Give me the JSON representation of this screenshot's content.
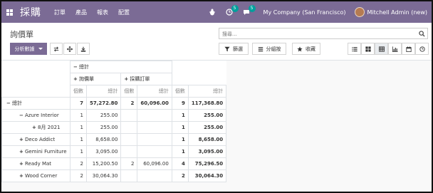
{
  "navbar": {
    "app_title": "採購",
    "menu": [
      "訂單",
      "產品",
      "報表",
      "配置"
    ],
    "chat_badge": "5",
    "activity_badge": "5",
    "company": "My Company (San Francisco)",
    "user": "Mitchell Admin (new)",
    "bg_color": "#7b6b95"
  },
  "control_panel": {
    "breadcrumb": "詢價單",
    "search_placeholder": "搜尋...",
    "measures_label": "分析數據",
    "filter_label": "篩選",
    "groupby_label": "分組按",
    "favorites_label": "收藏"
  },
  "pivot": {
    "col_total": "總計",
    "col_groups": [
      "詢價單",
      "採購訂單"
    ],
    "measures": [
      "個數",
      "總計"
    ],
    "total_row": {
      "label": "總計",
      "c1": "7",
      "v1": "57,272.80",
      "c2": "2",
      "v2": "60,096.00",
      "c3": "9",
      "v3": "117,368.80"
    },
    "rows": [
      {
        "label": "Azure Interior",
        "toggle": "−",
        "c1": "1",
        "v1": "255.00",
        "c2": "",
        "v2": "",
        "c3": "1",
        "v3": "255.00"
      },
      {
        "label": "8月 2021",
        "toggle": "+",
        "c1": "1",
        "v1": "255.00",
        "c2": "",
        "v2": "",
        "c3": "1",
        "v3": "255.00"
      },
      {
        "label": "Deco Addict",
        "toggle": "+",
        "c1": "1",
        "v1": "8,658.00",
        "c2": "",
        "v2": "",
        "c3": "1",
        "v3": "8,658.00"
      },
      {
        "label": "Gemini Furniture",
        "toggle": "+",
        "c1": "1",
        "v1": "3,095.00",
        "c2": "",
        "v2": "",
        "c3": "1",
        "v3": "3,095.00"
      },
      {
        "label": "Ready Mat",
        "toggle": "+",
        "c1": "2",
        "v1": "15,200.50",
        "c2": "2",
        "v2": "60,096.00",
        "c3": "4",
        "v3": "75,296.50"
      },
      {
        "label": "Wood Corner",
        "toggle": "+",
        "c1": "2",
        "v1": "30,064.30",
        "c2": "",
        "v2": "",
        "c3": "2",
        "v3": "30,064.30"
      }
    ]
  }
}
